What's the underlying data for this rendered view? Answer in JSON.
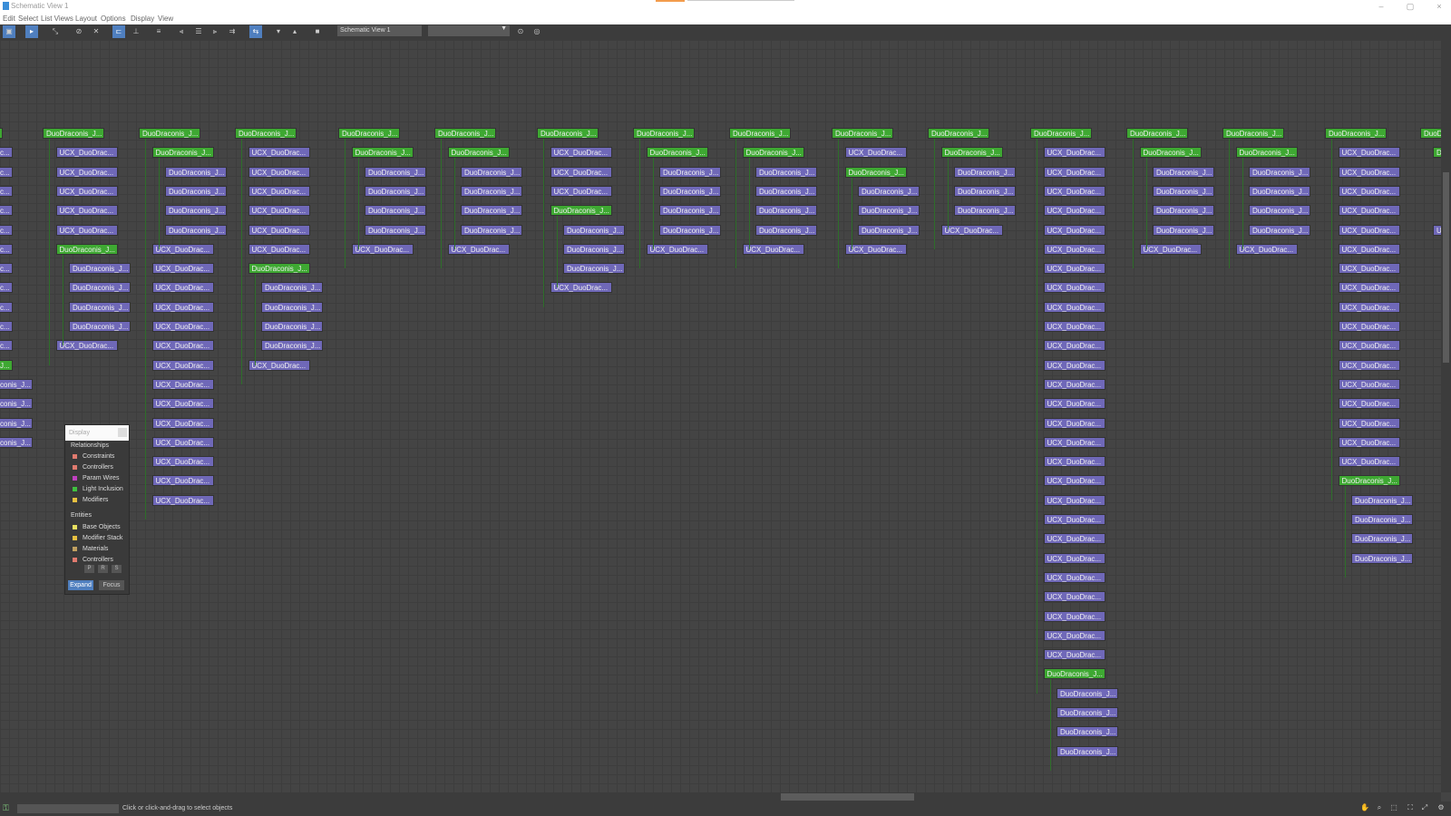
{
  "window": {
    "title": "Schematic View 1",
    "minimize": "–",
    "maximize": "▢",
    "close": "×"
  },
  "menu": [
    "Edit",
    "Select",
    "List Views",
    "Layout",
    "Options",
    "Display",
    "View"
  ],
  "toolbar": {
    "view_name": "Schematic View 1",
    "dropdown_value": ""
  },
  "display_panel": {
    "title": "Display",
    "relationships_label": "Relationships",
    "relationships": [
      {
        "label": "Constraints",
        "color": "#e07a6e"
      },
      {
        "label": "Controllers",
        "color": "#e07a6e"
      },
      {
        "label": "Param Wires",
        "color": "#c040c0"
      },
      {
        "label": "Light Inclusion",
        "color": "#40c040"
      },
      {
        "label": "Modifiers",
        "color": "#e8c040"
      }
    ],
    "entities_label": "Entities",
    "entities": [
      {
        "label": "Base Objects",
        "color": "#e8e060"
      },
      {
        "label": "Modifier Stack",
        "color": "#e8c040"
      },
      {
        "label": "Materials",
        "color": "#c0a060"
      },
      {
        "label": "Controllers",
        "color": "#e07a6e"
      }
    ],
    "small_buttons": [
      "P",
      "R",
      "S"
    ],
    "expand": "Expand",
    "focus": "Focus"
  },
  "node_labels": {
    "green": "DuoDraconis_J...",
    "purple_ucx": "UCX_DuoDrac...",
    "purple_duo": "DuoDraconis_J...",
    "edge_ucx": "c...",
    "edge_green": "J...",
    "edge_duo": "conis_J..."
  },
  "status": {
    "message": "Click or click-and-drag to select objects"
  },
  "colors": {
    "green_node": "#3ea832",
    "purple_node": "#6f68b8",
    "canvas": "#444444",
    "accent": "#4f7fbf"
  }
}
